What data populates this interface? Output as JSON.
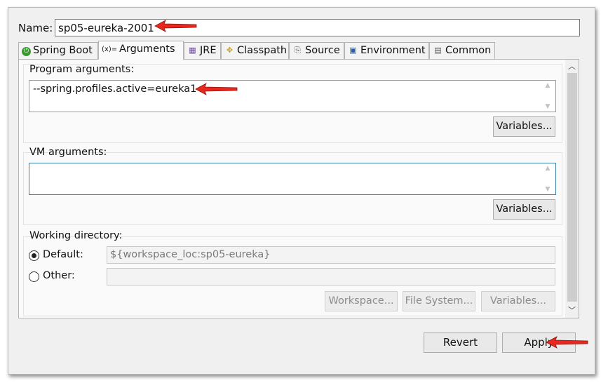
{
  "name": {
    "label": "Name:",
    "value": "sp05-eureka-2001"
  },
  "tabs": [
    {
      "label": "Spring Boot",
      "icon": "spring-boot-icon"
    },
    {
      "label": "Arguments",
      "icon": "arguments-icon",
      "icon_text": "(x)="
    },
    {
      "label": "JRE",
      "icon": "jre-icon"
    },
    {
      "label": "Classpath",
      "icon": "classpath-icon"
    },
    {
      "label": "Source",
      "icon": "source-icon"
    },
    {
      "label": "Environment",
      "icon": "environment-icon"
    },
    {
      "label": "Common",
      "icon": "common-icon"
    }
  ],
  "program_args": {
    "label": "Program arguments:",
    "value": "--spring.profiles.active=eureka1",
    "variables_button": "Variables..."
  },
  "vm_args": {
    "label": "VM arguments:",
    "value": "",
    "variables_button": "Variables..."
  },
  "working_dir": {
    "label": "Working directory:",
    "default_label": "Default:",
    "default_value": "${workspace_loc:sp05-eureka}",
    "other_label": "Other:",
    "other_value": "",
    "workspace_button": "Workspace...",
    "filesystem_button": "File System...",
    "variables_button": "Variables..."
  },
  "footer": {
    "revert": "Revert",
    "apply": "Apply"
  },
  "annotation_color": "#e8281e"
}
